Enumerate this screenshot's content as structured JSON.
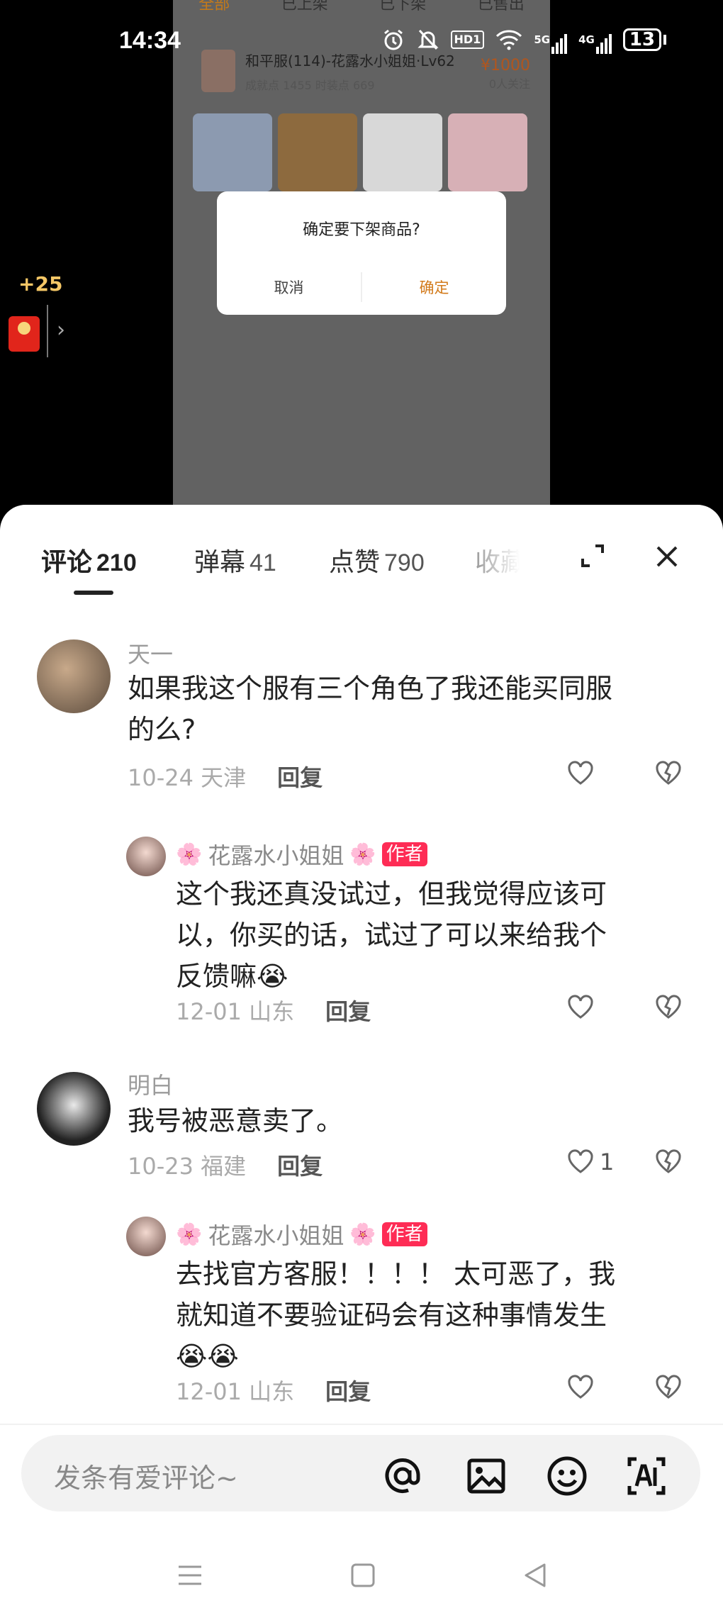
{
  "status_bar": {
    "time": "14:34",
    "network1": "5G",
    "network2": "4G",
    "hd_label": "HD1",
    "battery": "13"
  },
  "video": {
    "tabs": [
      "全部",
      "已上架",
      "已下架",
      "已售出"
    ],
    "product": {
      "title": "和平服(114)-花露水小姐姐·Lv62",
      "stats": "成就点 1455    时装点 669",
      "price": "¥1000",
      "followers": "0人关注"
    },
    "dialog": {
      "question": "确定要下架商品?",
      "cancel": "取消",
      "confirm": "确定"
    }
  },
  "red_packet": {
    "bonus": "+25"
  },
  "sheet": {
    "tabs": [
      {
        "label": "评论",
        "count": "210"
      },
      {
        "label": "弹幕",
        "count": "41"
      },
      {
        "label": "点赞",
        "count": "790"
      },
      {
        "label": "收藏",
        "count": ""
      }
    ],
    "comments": [
      {
        "user": "天一",
        "text_line1": "如果我这个服有三个角色了我还能买同服",
        "text_line2": "的么?",
        "date": "10-24",
        "region": "天津",
        "reply_label": "回复",
        "likes": ""
      },
      {
        "user": "花露水小姐姐",
        "author_tag": "作者",
        "text_line1": "这个我还真没试过，但我觉得应该可",
        "text_line2": "以，你买的话，试过了可以来给我个",
        "text_line3": "反馈嘛😭",
        "date": "12-01",
        "region": "山东",
        "reply_label": "回复"
      },
      {
        "user": "明白",
        "text_line1": "我号被恶意卖了。",
        "date": "10-23",
        "region": "福建",
        "reply_label": "回复",
        "likes": "1"
      },
      {
        "user": "花露水小姐姐",
        "author_tag": "作者",
        "text_line1": "去找官方客服！！！！ 太可恶了，我",
        "text_line2": "就知道不要验证码会有这种事情发生",
        "text_line3": "😭😭",
        "date": "12-01",
        "region": "山东",
        "reply_label": "回复"
      }
    ],
    "input_placeholder": "发条有爱评论~",
    "input_icons": [
      "at-icon",
      "image-icon",
      "emoji-icon",
      "ai-icon"
    ]
  },
  "colors": {
    "accent_red": "#fe2c55",
    "dialog_confirm": "#d27a1b",
    "bonus_gold": "#f5c766"
  }
}
